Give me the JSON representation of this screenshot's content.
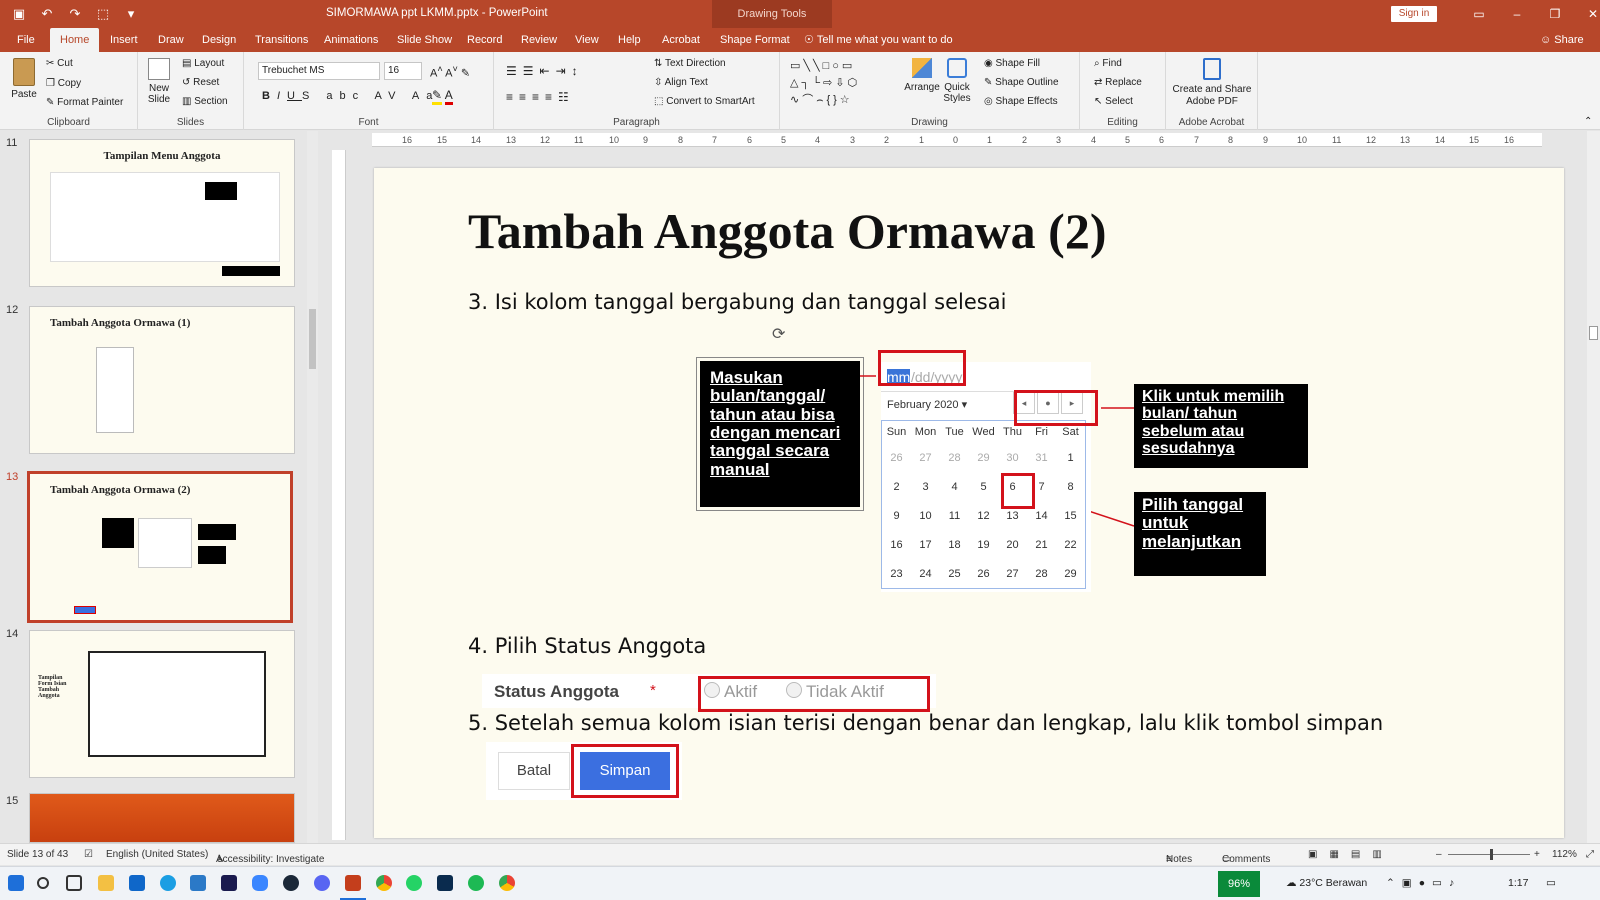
{
  "titlebar": {
    "doc_title": "SIMORMAWA ppt LKMM.pptx  -  PowerPoint",
    "tools_label": "Drawing Tools",
    "signin": "Sign in",
    "qat": [
      "▣",
      "↶",
      "↷",
      "⬚",
      "▾"
    ]
  },
  "tabs": {
    "file": "File",
    "home": "Home",
    "insert": "Insert",
    "draw": "Draw",
    "design": "Design",
    "transitions": "Transitions",
    "animations": "Animations",
    "slideshow": "Slide Show",
    "record": "Record",
    "review": "Review",
    "view": "View",
    "help": "Help",
    "acrobat": "Acrobat",
    "shapeformat": "Shape Format",
    "tellme": "Tell me what you want to do",
    "share": "Share"
  },
  "ribbon": {
    "clipboard": {
      "label": "Clipboard",
      "paste": "Paste",
      "cut": "Cut",
      "copy": "Copy",
      "painter": "Format Painter"
    },
    "slides": {
      "label": "Slides",
      "new": "New Slide",
      "layout": "Layout",
      "reset": "Reset",
      "section": "Section"
    },
    "font": {
      "label": "Font",
      "family": "Trebuchet MS",
      "size": "16"
    },
    "paragraph": {
      "label": "Paragraph",
      "textdir": "Text Direction",
      "align": "Align Text",
      "smartart": "Convert to SmartArt"
    },
    "drawing": {
      "label": "Drawing",
      "arrange": "Arrange",
      "quick": "Quick Styles",
      "fill": "Shape Fill",
      "outline": "Shape Outline",
      "effects": "Shape Effects"
    },
    "editing": {
      "label": "Editing",
      "find": "Find",
      "replace": "Replace",
      "select": "Select"
    },
    "acrobat": {
      "label": "Adobe Acrobat",
      "create": "Create and Share Adobe PDF"
    }
  },
  "ruler": {
    "marks": [
      "16",
      "15",
      "14",
      "13",
      "12",
      "11",
      "10",
      "9",
      "8",
      "7",
      "6",
      "5",
      "4",
      "3",
      "2",
      "1",
      "0",
      "1",
      "2",
      "3",
      "4",
      "5",
      "6",
      "7",
      "8",
      "9",
      "10",
      "11",
      "12",
      "13",
      "14",
      "15",
      "16"
    ]
  },
  "thumbs": [
    {
      "num": "11",
      "title": "Tampilan Menu Anggota"
    },
    {
      "num": "12",
      "title": "Tambah Anggota Ormawa (1)"
    },
    {
      "num": "13",
      "title": "Tambah Anggota Ormawa (2)"
    },
    {
      "num": "14",
      "title": "Tampilan Form Isian Tambah Anggota"
    },
    {
      "num": "15",
      "title": ""
    }
  ],
  "slide": {
    "title": "Tambah Anggota Ormawa (2)",
    "step3": "3. Isi kolom tanggal bergabung dan tanggal selesai",
    "step4": "4. Pilih Status Anggota",
    "step5": "5. Setelah semua kolom isian terisi dengan benar dan lengkap, lalu klik tombol simpan",
    "callout_left": "Masukan bulan/tanggal/ tahun atau bisa dengan mencari tanggal secara manual",
    "callout_nav": "Klik untuk memilih bulan/ tahun sebelum atau sesudahnya",
    "callout_pick": "Pilih tanggal untuk melanjutkan",
    "date_mm": "mm",
    "date_rest": "/dd/yyyy",
    "cal_month": "February 2020 ▾",
    "cal_days": [
      "Sun",
      "Mon",
      "Tue",
      "Wed",
      "Thu",
      "Fri",
      "Sat"
    ],
    "cal_weeks": [
      [
        "26",
        "27",
        "28",
        "29",
        "30",
        "31",
        "1"
      ],
      [
        "2",
        "3",
        "4",
        "5",
        "6",
        "7",
        "8"
      ],
      [
        "9",
        "10",
        "11",
        "12",
        "13",
        "14",
        "15"
      ],
      [
        "16",
        "17",
        "18",
        "19",
        "20",
        "21",
        "22"
      ],
      [
        "23",
        "24",
        "25",
        "26",
        "27",
        "28",
        "29"
      ]
    ],
    "status_label": "Status Anggota",
    "required": "*",
    "opt_aktif": "Aktif",
    "opt_tidak": "Tidak Aktif",
    "btn_batal": "Batal",
    "btn_simpan": "Simpan"
  },
  "status": {
    "slide": "Slide 13 of 43",
    "lang": "English (United States)",
    "access": "Accessibility: Investigate",
    "notes": "Notes",
    "comments": "Comments",
    "zoom": "112%"
  },
  "taskbar": {
    "battery": "96%",
    "weather": "23°C  Berawan",
    "time": "1:17"
  }
}
